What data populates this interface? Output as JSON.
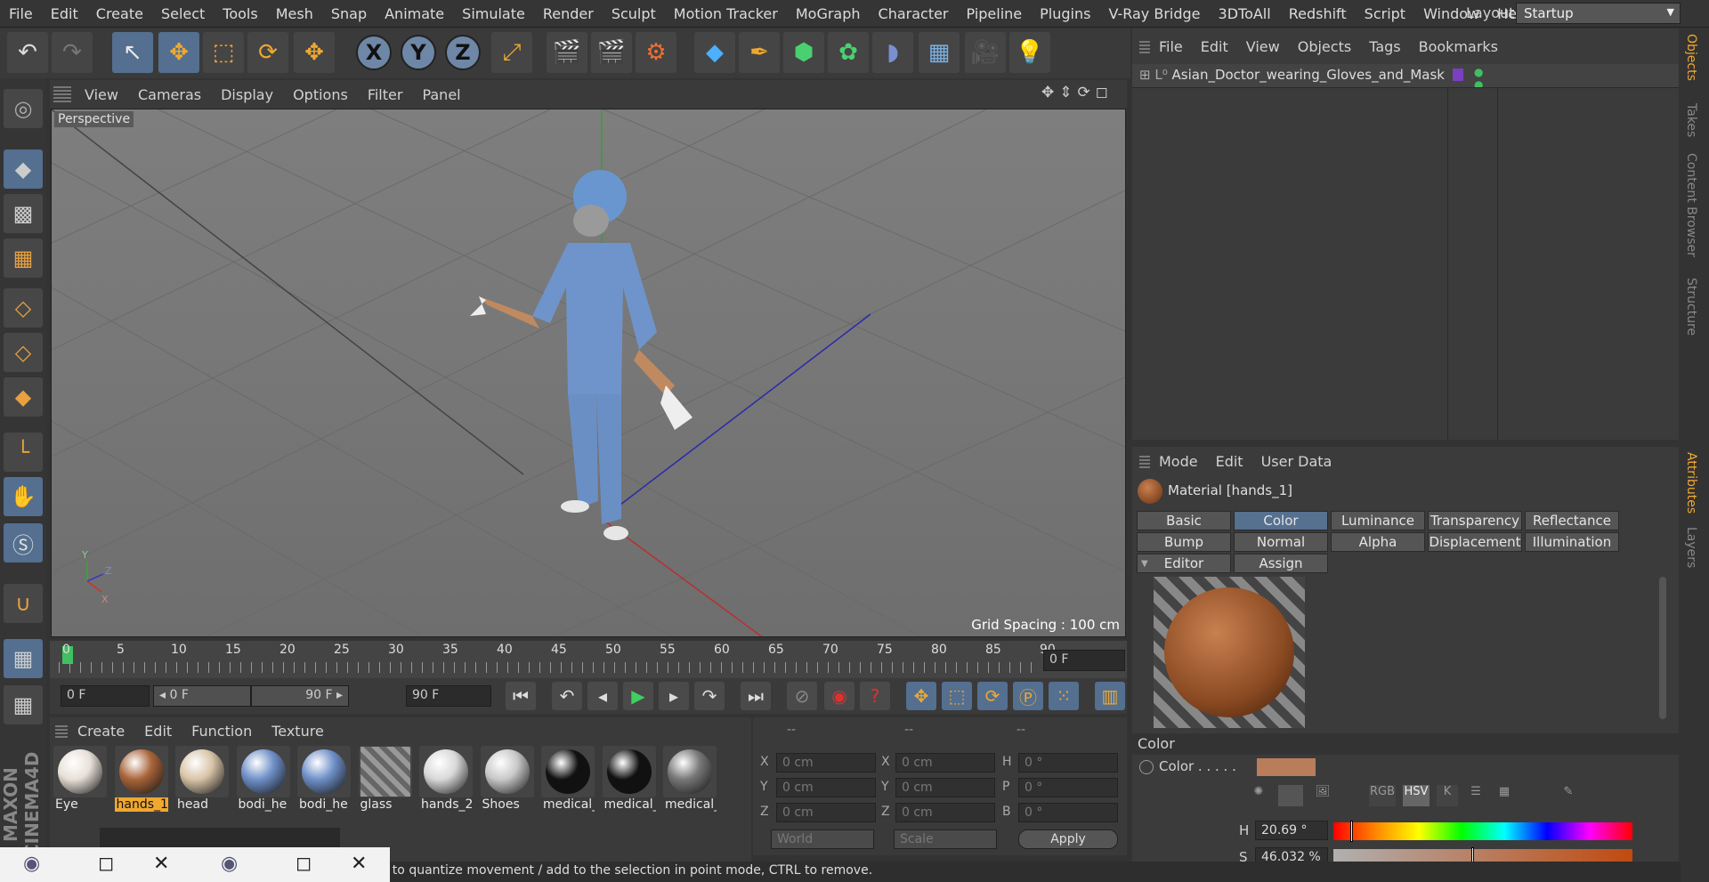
{
  "menubar": {
    "items": [
      "File",
      "Edit",
      "Create",
      "Select",
      "Tools",
      "Mesh",
      "Snap",
      "Animate",
      "Simulate",
      "Render",
      "Sculpt",
      "Motion Tracker",
      "MoGraph",
      "Character",
      "Pipeline",
      "Plugins",
      "V-Ray Bridge",
      "3DToAll",
      "Redshift",
      "Script",
      "Window",
      "Help"
    ],
    "layout_label": "Layout:",
    "layout_value": "Startup"
  },
  "toolbar": {
    "undo": "↶",
    "redo": "↷",
    "select": "↖",
    "move": "✥",
    "scale": "⬚",
    "rotate": "⟳",
    "axis_x": "X",
    "axis_y": "Y",
    "axis_z": "Z",
    "coord": "⤢",
    "render_region": "🎬",
    "render_view": "🎬",
    "render_settings": "⚙",
    "cube": "◆",
    "pen": "✒",
    "subdiv": "⬢",
    "mograph": "✿",
    "deformer": "◗",
    "floor": "▦",
    "camera": "🎥",
    "light": "💡"
  },
  "viewport": {
    "menu": [
      "View",
      "Cameras",
      "Display",
      "Options",
      "Filter",
      "Panel"
    ],
    "label": "Perspective",
    "grid_spacing": "Grid Spacing : 100 cm",
    "nav_icons": [
      "✥",
      "⇕",
      "⟳",
      "◻"
    ]
  },
  "timeline": {
    "ticks": [
      "0",
      "5",
      "10",
      "15",
      "20",
      "25",
      "30",
      "35",
      "40",
      "45",
      "50",
      "55",
      "60",
      "65",
      "70",
      "75",
      "80",
      "85",
      "90"
    ],
    "current_frame": "0 F"
  },
  "transport": {
    "start": "0 F",
    "range_start": "◂ 0 F",
    "range_end": "90 F ▸",
    "end": "90 F"
  },
  "material_manager": {
    "menu": [
      "Create",
      "Edit",
      "Function",
      "Texture"
    ],
    "materials": [
      {
        "name": "Eye",
        "color": "#e8e0d8"
      },
      {
        "name": "hands_1",
        "color": "#a8643a",
        "selected": true
      },
      {
        "name": "head",
        "color": "#d9c4a8"
      },
      {
        "name": "bodi_he",
        "color": "#6f90c8"
      },
      {
        "name": "bodi_he",
        "color": "#6f90c8"
      },
      {
        "name": "glass",
        "color": "#888"
      },
      {
        "name": "hands_2",
        "color": "#d8d8d8"
      },
      {
        "name": "Shoes",
        "color": "#c8c8c8"
      },
      {
        "name": "medical_",
        "color": "#111"
      },
      {
        "name": "medical_",
        "color": "#111"
      },
      {
        "name": "medical_",
        "color": "#777"
      }
    ]
  },
  "coordinates": {
    "headers": [
      "--",
      "--",
      "--"
    ],
    "labels_left": [
      "X",
      "Y",
      "Z"
    ],
    "labels_mid": [
      "X",
      "Y",
      "Z"
    ],
    "labels_right": [
      "H",
      "P",
      "B"
    ],
    "pos": [
      "0 cm",
      "0 cm",
      "0 cm"
    ],
    "size": [
      "0 cm",
      "0 cm",
      "0 cm"
    ],
    "rot": [
      "0 °",
      "0 °",
      "0 °"
    ],
    "world": "World",
    "scale": "Scale",
    "apply": "Apply"
  },
  "object_manager": {
    "menu": [
      "File",
      "Edit",
      "View",
      "Objects",
      "Tags",
      "Bookmarks"
    ],
    "object_name": "Asian_Doctor_wearing_Gloves_and_Mask"
  },
  "side_tabs": [
    "Objects",
    "Takes",
    "Content Browser",
    "Structure",
    "Attributes",
    "Layers"
  ],
  "attributes": {
    "menu": [
      "Mode",
      "Edit",
      "User Data"
    ],
    "title": "Material [hands_1]",
    "tabs_row1": [
      "Basic",
      "Color",
      "Luminance",
      "Transparency",
      "Reflectance"
    ],
    "tabs_row2": [
      "Bump",
      "Normal",
      "Alpha",
      "Displacement",
      "Illumination"
    ],
    "tabs_row3": [
      "Editor",
      "Assign"
    ],
    "active_tab": "Color",
    "section": "Color",
    "color_label": "Color . . . . .",
    "swatch": "#b97d5c",
    "modes": [
      "RGB",
      "HSV",
      "K"
    ],
    "h_label": "H",
    "h_value": "20.69 °",
    "s_label": "S",
    "s_value": "46.032 %"
  },
  "status": {
    "text": "FT to quantize movement / add to the selection in point mode, CTRL to remove."
  },
  "taskbar": {
    "win1": [
      "◻",
      "✕"
    ],
    "win2": [
      "◻",
      "✕"
    ]
  },
  "logo": {
    "text": "MAXON CINEMA4D"
  }
}
